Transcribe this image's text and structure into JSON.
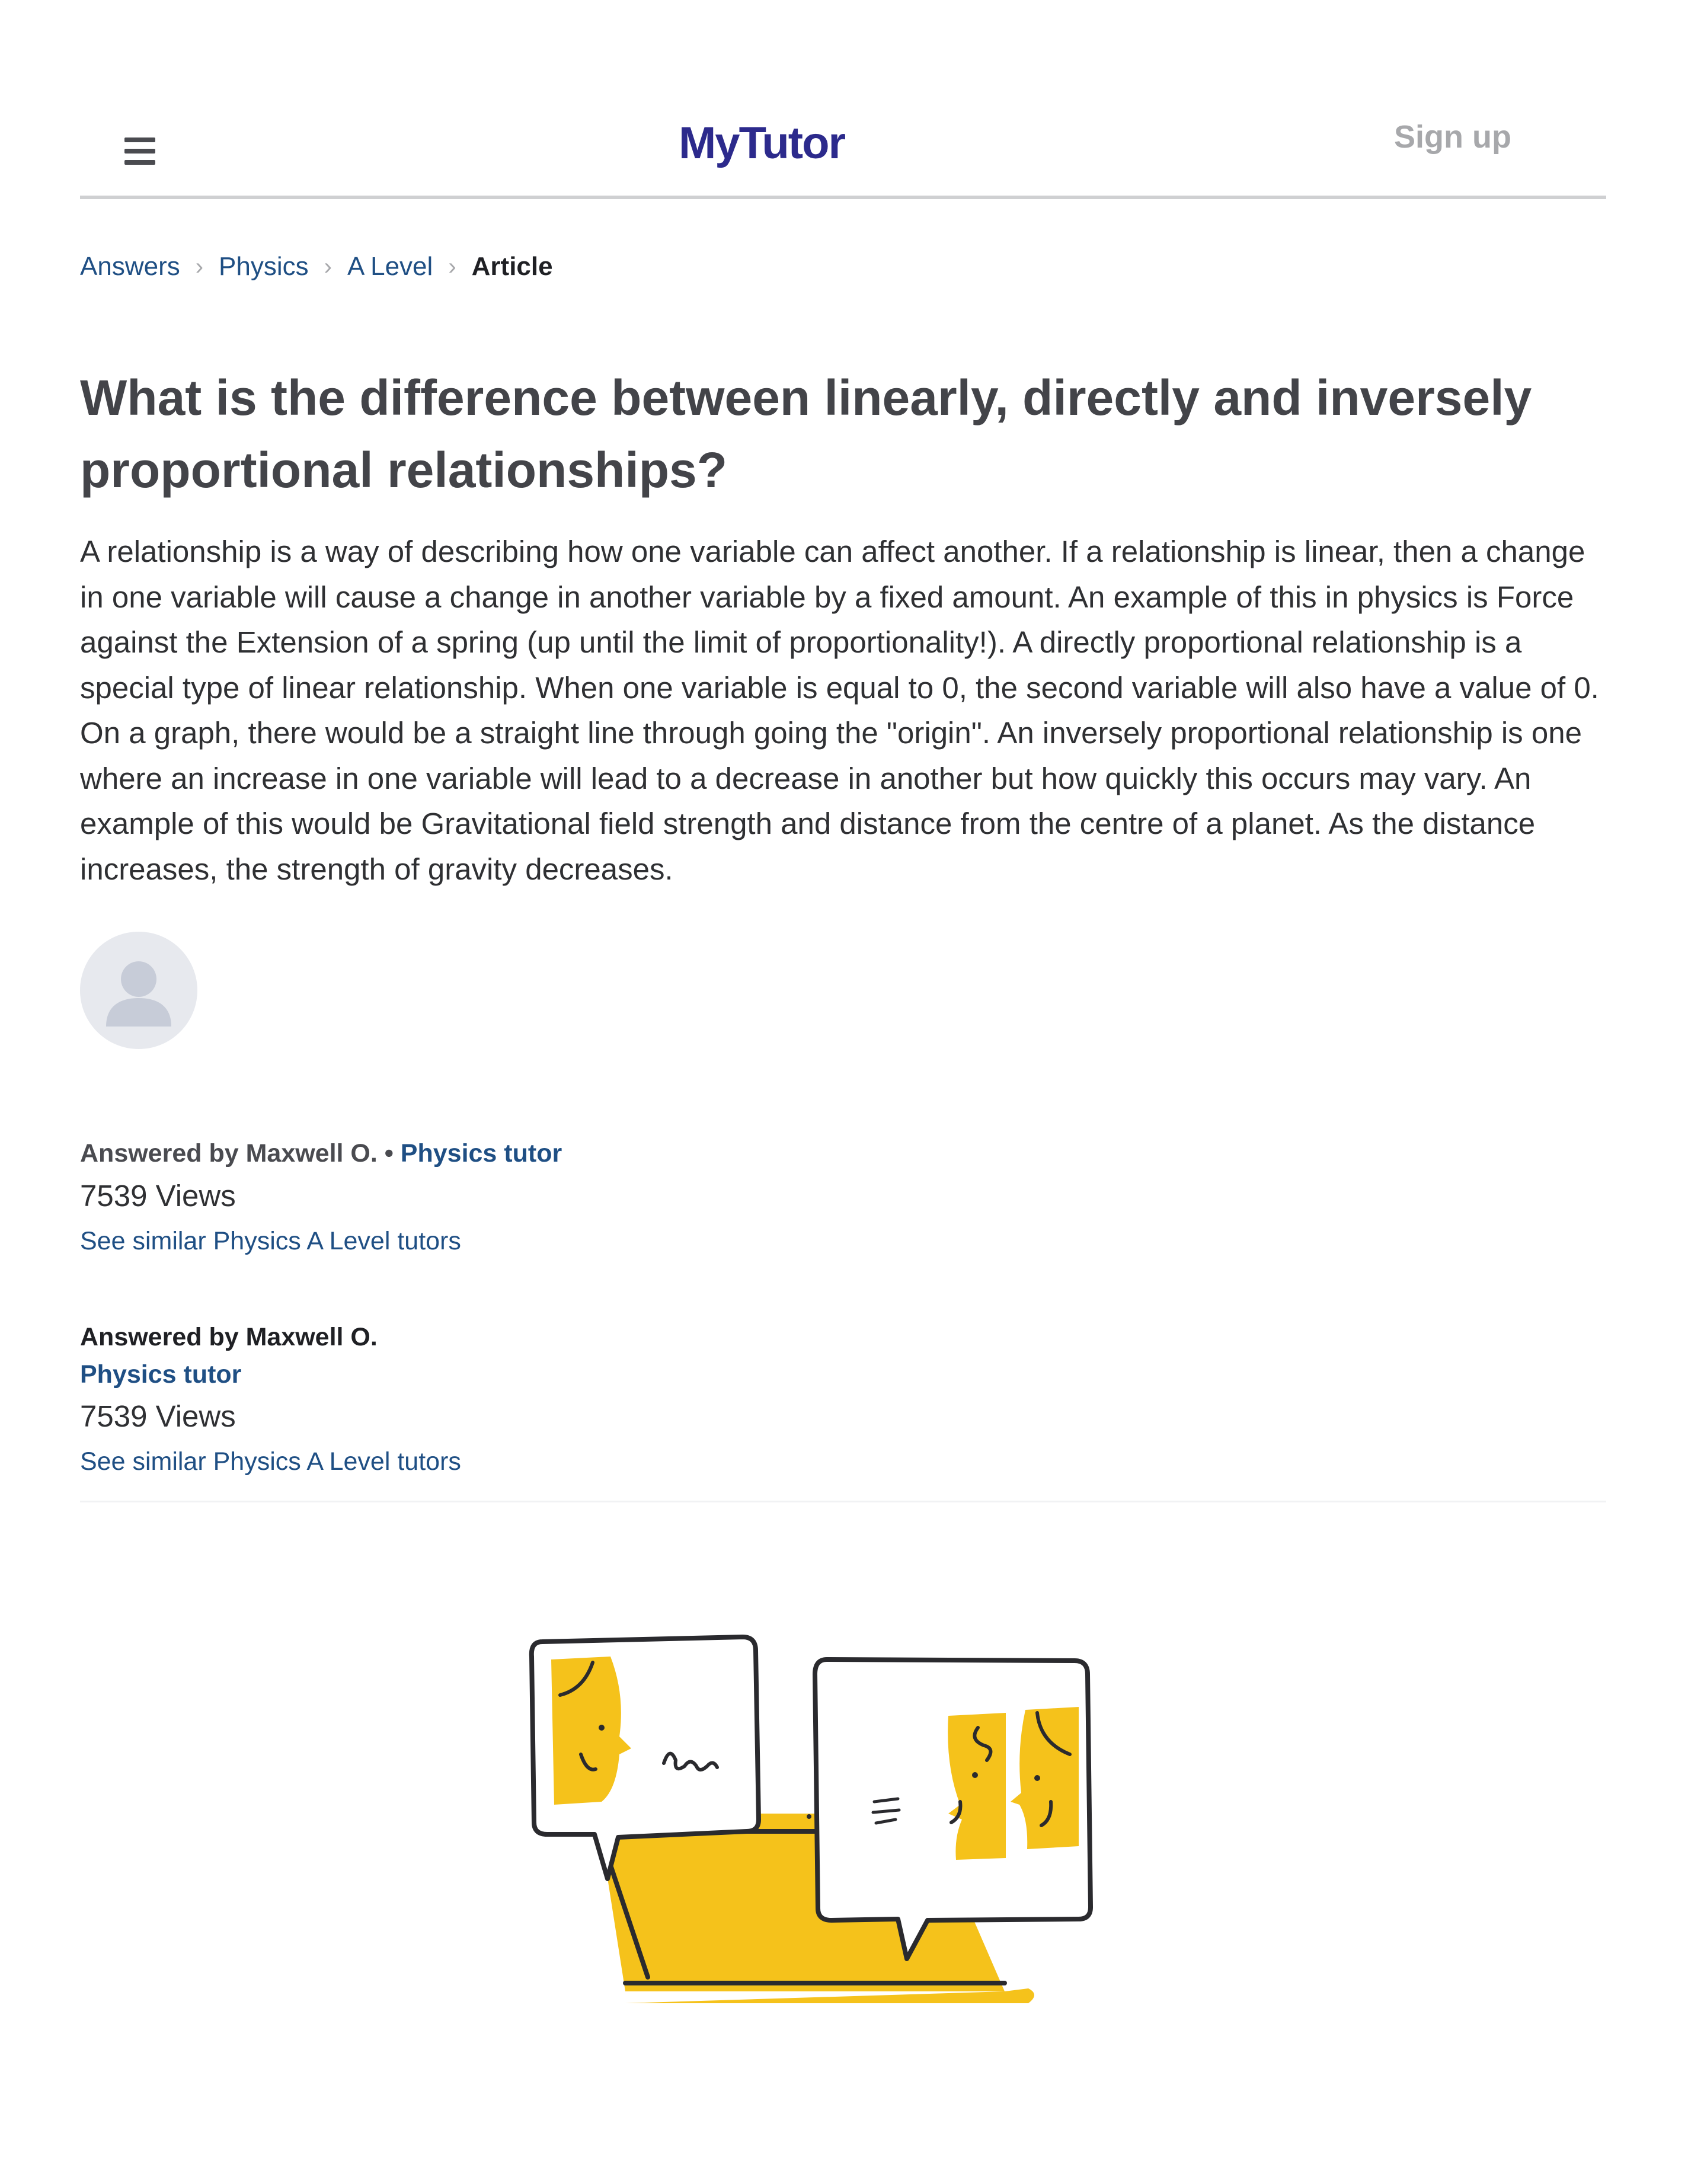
{
  "header": {
    "logo_text": "MyTutor",
    "signup_label": "Sign up",
    "menu_icon": "hamburger-menu-icon"
  },
  "breadcrumb": {
    "items": [
      "Answers",
      "Physics",
      "A Level"
    ],
    "current": "Article",
    "separator_icon": "chevron-right-icon"
  },
  "article": {
    "title": "What is the difference between linearly, directly and inversely proportional relationships?",
    "body": "A relationship is a way of describing how one variable can affect another. If a relationship is linear, then a change in one variable will cause a change in another variable by a fixed amount. An example of this in physics is Force against the Extension of a spring (up until the limit of proportionality!). A directly proportional relationship is a special type of linear relationship. When one variable is equal to 0, the second variable will also have a value of 0. On a graph, there would be a straight line through going the \"origin\". An inversely proportional relationship is one where an increase in one variable will lead to a decrease in another but how quickly this occurs may vary. An example of this would be Gravitational field strength and distance from the centre of a planet. As the distance increases, the strength of gravity decreases."
  },
  "author_block_1": {
    "answered_by": "Answered by Maxwell O.",
    "bullet": "•",
    "tutor_link": "Physics tutor",
    "views": "7539 Views",
    "similar_link": "See similar Physics A Level tutors"
  },
  "author_block_2": {
    "answered_by": "Answered by Maxwell O.",
    "tutor_link": "Physics tutor",
    "views": "7539 Views",
    "similar_link": "See similar Physics A Level tutors"
  },
  "colors": {
    "brand": "#2c2a8c",
    "link": "#1f4f84",
    "illustration_yellow": "#f5c21b",
    "illustration_stroke": "#2a2a2e"
  }
}
